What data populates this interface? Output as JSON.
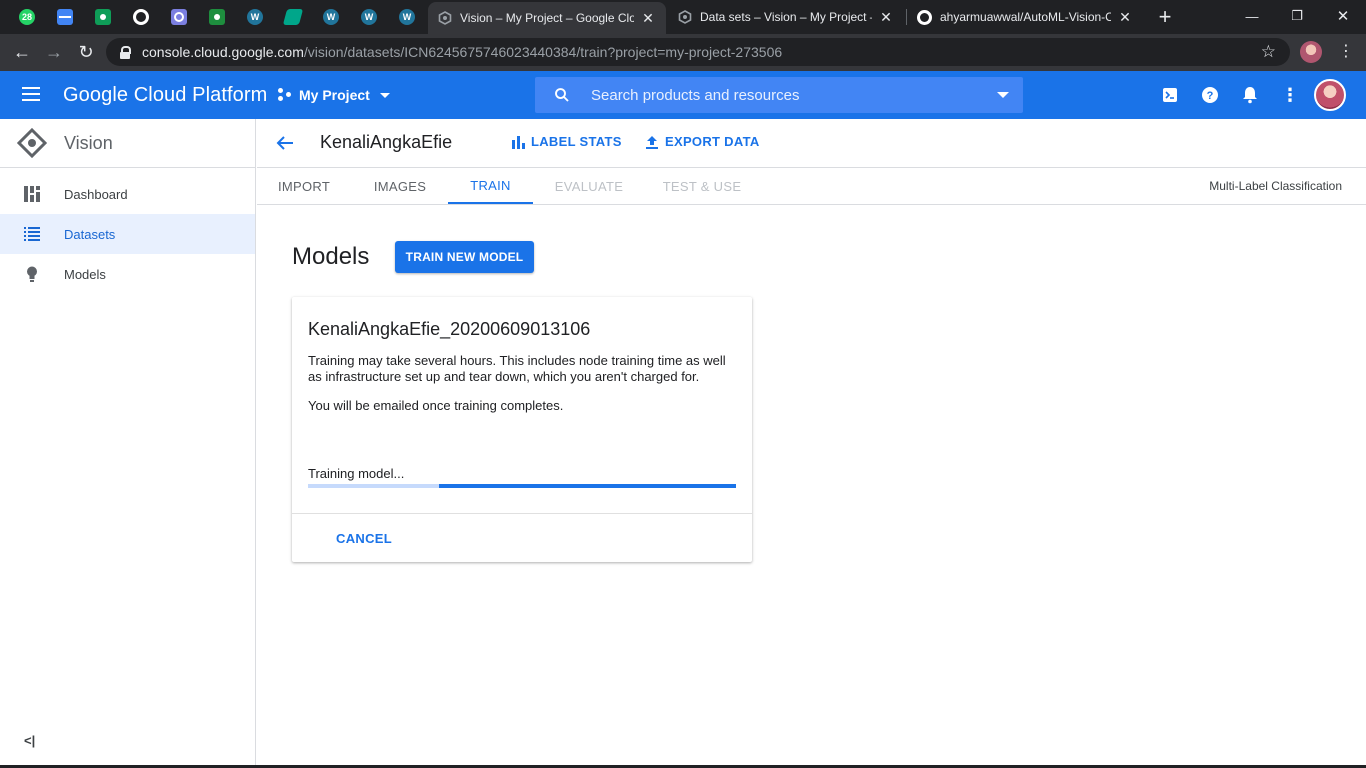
{
  "browser": {
    "pinned_tabs": [
      {
        "icon": "whatsapp-icon",
        "color": "#25d366",
        "badge": "28"
      },
      {
        "icon": "card-icon",
        "color": "#4285f4"
      },
      {
        "icon": "classroom-icon",
        "color": "#0f9d58"
      },
      {
        "icon": "github-icon",
        "color": "#ffffff"
      },
      {
        "icon": "site-icon",
        "color": "#7b7fe0"
      },
      {
        "icon": "classroom-icon",
        "color": "#1e8e3e"
      },
      {
        "icon": "wordpress-icon",
        "color": "#21759b"
      },
      {
        "icon": "app-icon",
        "color": "#00a68a"
      },
      {
        "icon": "wordpress-icon",
        "color": "#21759b"
      },
      {
        "icon": "wordpress-icon",
        "color": "#21759b"
      },
      {
        "icon": "wordpress-icon",
        "color": "#21759b"
      }
    ],
    "tabs": [
      {
        "title": "Vision – My Project – Google Cloud",
        "active": true
      },
      {
        "title": "Data sets – Vision – My Project – Google Cloud",
        "active": false
      },
      {
        "title": "ahyarmuawwal/AutoML-Vision-Classification",
        "active": false
      }
    ],
    "url_host": "console.cloud.google.com",
    "url_path": "/vision/datasets/ICN6245675746023440384/train?project=my-project-273506"
  },
  "header": {
    "title": "Google Cloud Platform",
    "project": "My Project",
    "search_placeholder": "Search products and resources",
    "accent": "#1a73e8"
  },
  "sidebar": {
    "product": "Vision",
    "items": [
      {
        "label": "Dashboard",
        "icon": "dashboard-icon",
        "active": false
      },
      {
        "label": "Datasets",
        "icon": "list-icon",
        "active": true
      },
      {
        "label": "Models",
        "icon": "lightbulb-icon",
        "active": false
      }
    ],
    "collapse_label": "<|"
  },
  "dataset": {
    "name": "KenaliAngkaEfie",
    "label_stats": "LABEL STATS",
    "export_data": "EXPORT DATA"
  },
  "content_tabs": [
    {
      "label": "IMPORT",
      "state": "normal"
    },
    {
      "label": "IMAGES",
      "state": "normal"
    },
    {
      "label": "TRAIN",
      "state": "active"
    },
    {
      "label": "EVALUATE",
      "state": "disabled"
    },
    {
      "label": "TEST & USE",
      "state": "disabled"
    }
  ],
  "classification_type": "Multi-Label Classification",
  "main": {
    "title": "Models",
    "train_button": "TRAIN NEW MODEL",
    "card": {
      "model_name": "KenaliAngkaEfie_20200609013106",
      "description": "Training may take several hours. This includes node training time as well as infrastructure set up and tear down, which you aren't charged for.",
      "email_note": "You will be emailed once training completes.",
      "status": "Training model...",
      "cancel": "CANCEL"
    }
  }
}
